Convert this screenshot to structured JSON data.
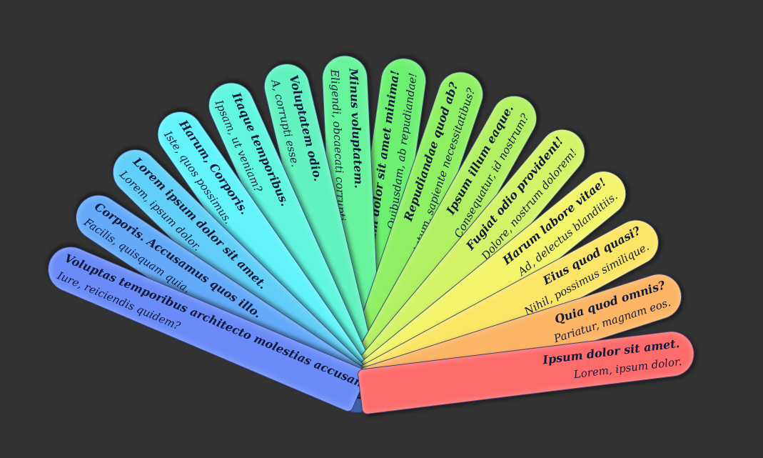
{
  "blades": [
    {
      "title": "Voluptas temporibus architecto molestias accusantium?",
      "subtitle": "Iure, reiciendis quidem?",
      "color": "#6b8cf8"
    },
    {
      "title": "Corporis. Accusamus quos illo.",
      "subtitle": "Facilis, quisquam quia.",
      "color": "#64aaf8"
    },
    {
      "title": "Lorem ipsum dolor sit amet.",
      "subtitle": "Lorem, ipsum dolor.",
      "color": "#62cff8"
    },
    {
      "title": "Harum, Corporis.",
      "subtitle": "Iste, quos possimus.",
      "color": "#62f3fb"
    },
    {
      "title": "Itaque temporibus.",
      "subtitle": "Ipsam, ut veniam?",
      "color": "#61f6e0"
    },
    {
      "title": "Voluptatem odio.",
      "subtitle": "A, corrupti esse.",
      "color": "#62f2c0"
    },
    {
      "title": "Minus voluptatem.",
      "subtitle": "Eligendi, obcaecati corrupti.",
      "color": "#66f39c"
    },
    {
      "title": "Lorem ipsum dolor sit amet minima!",
      "subtitle": "Quibusdam, ab repudiandae!",
      "color": "#6cf070"
    },
    {
      "title": "Repudiandae quod ab?",
      "subtitle": "Voluptatum, sapiente necessitatibus?",
      "color": "#8ef062"
    },
    {
      "title": "Ipsum illum eaque.",
      "subtitle": "Consequatur, id nostrum?",
      "color": "#b2f063"
    },
    {
      "title": "Fugiat odio provident!",
      "subtitle": "Dolore, nostrum dolorem!",
      "color": "#d4f368"
    },
    {
      "title": "Harum labore vitae!",
      "subtitle": "Ad, delectus blanditiis.",
      "color": "#f2f56a"
    },
    {
      "title": "Eius quod quasi?",
      "subtitle": "Nihil, possimus similique.",
      "color": "#fbe566"
    },
    {
      "title": "Quia quod omnis?",
      "subtitle": "Pariatur, magnam eos.",
      "color": "#fbb565"
    },
    {
      "title": "Ipsum dolor sit amet.",
      "subtitle": "Lorem, ipsum dolor.",
      "color": "#fd6b6b"
    }
  ]
}
